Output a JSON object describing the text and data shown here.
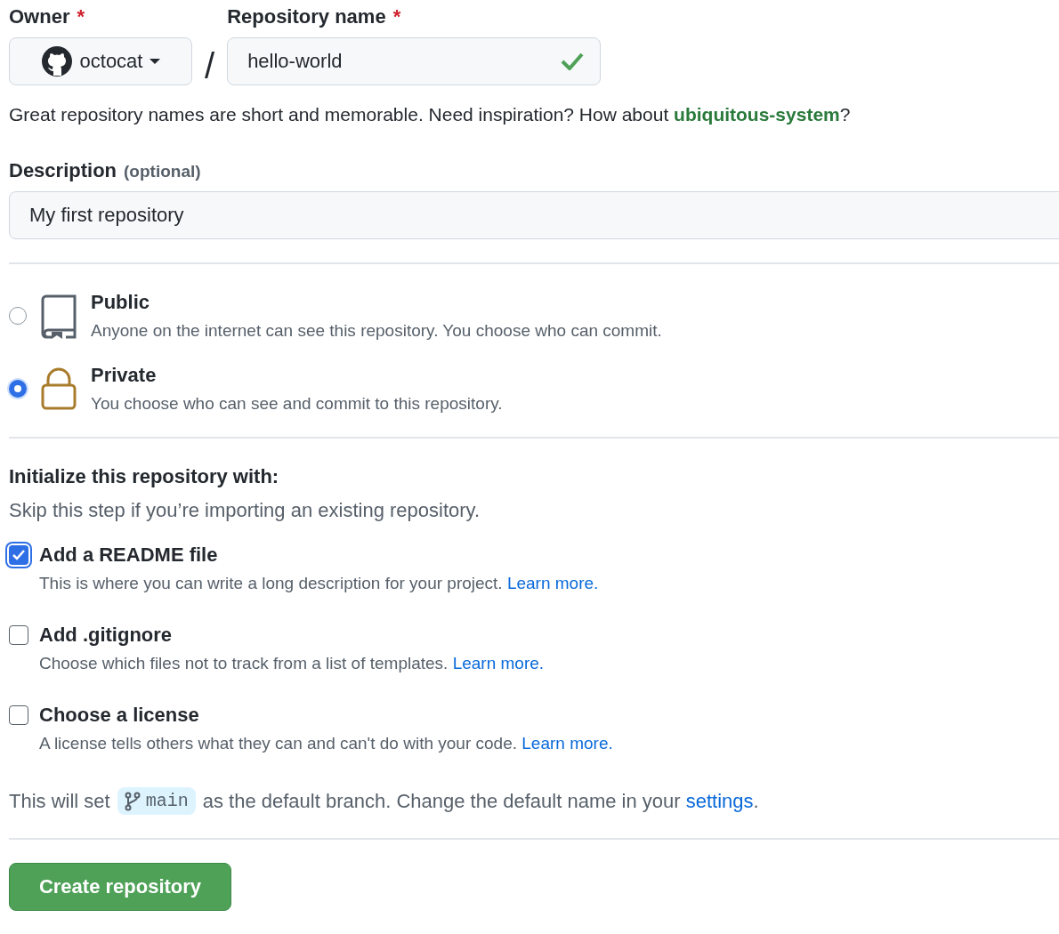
{
  "owner": {
    "label": "Owner",
    "required_mark": "*",
    "value": "octocat"
  },
  "separator": "/",
  "repo_name": {
    "label": "Repository name",
    "required_mark": "*",
    "value": "hello-world",
    "valid": true
  },
  "name_hint": {
    "before": "Great repository names are short and memorable. Need inspiration? How about ",
    "suggestion": "ubiquitous-system",
    "after": "?"
  },
  "description": {
    "label": "Description",
    "optional": "(optional)",
    "value": "My first repository"
  },
  "visibility": [
    {
      "kind": "book",
      "title": "Public",
      "description": "Anyone on the internet can see this repository. You choose who can commit.",
      "selected": false
    },
    {
      "kind": "lock",
      "title": "Private",
      "description": "You choose who can see and commit to this repository.",
      "selected": true
    }
  ],
  "initialize": {
    "title": "Initialize this repository with:",
    "subtitle": "Skip this step if you’re importing an existing repository.",
    "options": [
      {
        "label": "Add a README file",
        "description": "This is where you can write a long description for your project.",
        "link": "Learn more.",
        "checked": true
      },
      {
        "label": "Add .gitignore",
        "description": "Choose which files not to track from a list of templates.",
        "link": "Learn more.",
        "checked": false
      },
      {
        "label": "Choose a license",
        "description": "A license tells others what they can and can't do with your code.",
        "link": "Learn more.",
        "checked": false
      }
    ]
  },
  "default_branch": {
    "before": "This will set",
    "branch": "main",
    "middle": "as the default branch. Change the default name in your",
    "link": "settings",
    "after": "."
  },
  "submit_button": "Create repository"
}
